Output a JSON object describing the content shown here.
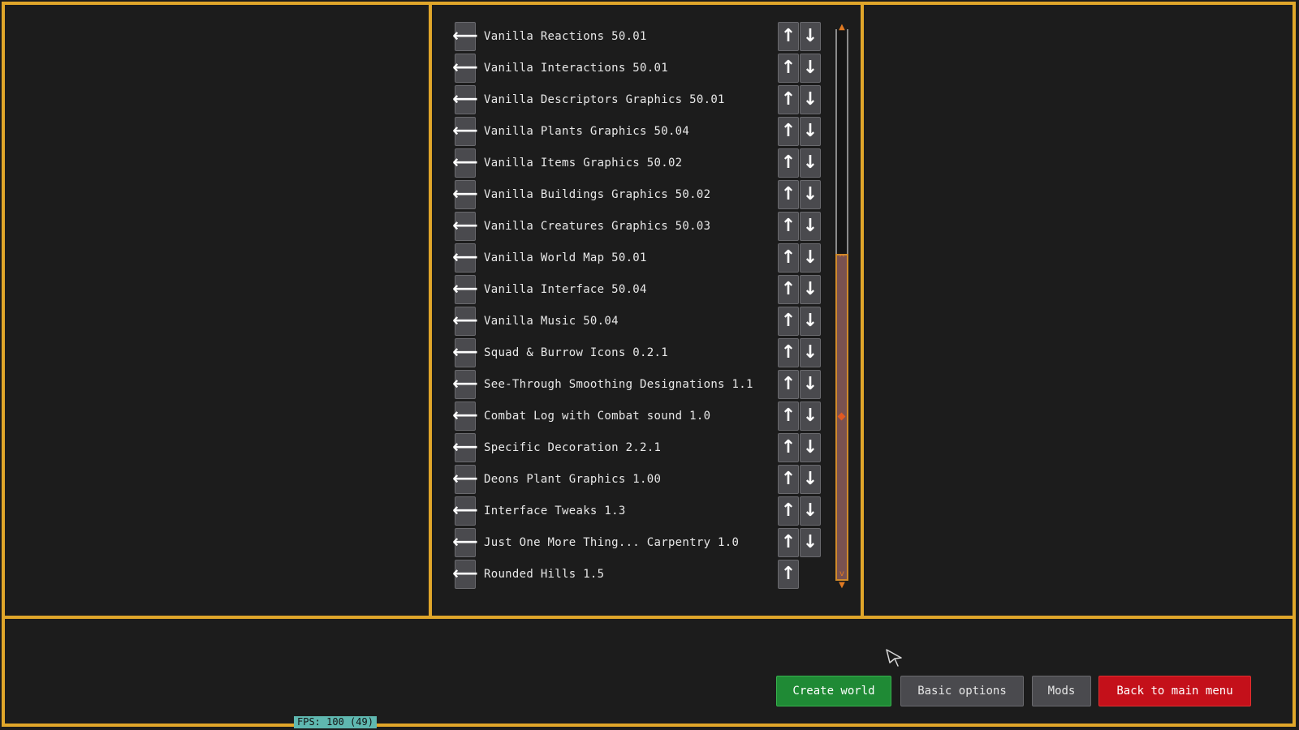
{
  "mods": [
    {
      "name": "Vanilla Reactions 50.01",
      "can_move_down": true
    },
    {
      "name": "Vanilla Interactions 50.01",
      "can_move_down": true
    },
    {
      "name": "Vanilla Descriptors Graphics 50.01",
      "can_move_down": true
    },
    {
      "name": "Vanilla Plants Graphics 50.04",
      "can_move_down": true
    },
    {
      "name": "Vanilla Items Graphics 50.02",
      "can_move_down": true
    },
    {
      "name": "Vanilla Buildings Graphics 50.02",
      "can_move_down": true
    },
    {
      "name": "Vanilla Creatures Graphics 50.03",
      "can_move_down": true
    },
    {
      "name": "Vanilla World Map 50.01",
      "can_move_down": true
    },
    {
      "name": "Vanilla Interface 50.04",
      "can_move_down": true
    },
    {
      "name": "Vanilla Music 50.04",
      "can_move_down": true
    },
    {
      "name": "Squad & Burrow Icons 0.2.1",
      "can_move_down": true
    },
    {
      "name": "See-Through Smoothing Designations 1.1",
      "can_move_down": true
    },
    {
      "name": "Combat Log with Combat sound 1.0",
      "can_move_down": true
    },
    {
      "name": "Specific Decoration 2.2.1",
      "can_move_down": true
    },
    {
      "name": "Deons Plant Graphics 1.00",
      "can_move_down": true
    },
    {
      "name": "Interface Tweaks 1.3",
      "can_move_down": true
    },
    {
      "name": "Just One More Thing... Carpentry 1.0",
      "can_move_down": true
    },
    {
      "name": "Rounded Hills 1.5",
      "can_move_down": false
    }
  ],
  "icons": {
    "remove": "arrow-left-icon",
    "move_up": "arrow-up-icon",
    "move_down": "arrow-down-icon",
    "remove_glyph": "⟵",
    "up_glyph": "↑",
    "down_glyph": "↓"
  },
  "footer": {
    "create_world": "Create world",
    "basic_options": "Basic options",
    "mods": "Mods",
    "back_to_main_menu": "Back to main menu"
  },
  "fps_label": "FPS: 100 (49)",
  "colors": {
    "border": "#e0a62a",
    "create": "#1f8a35",
    "back": "#c4101a",
    "fps_bg": "#5fb8b0"
  }
}
